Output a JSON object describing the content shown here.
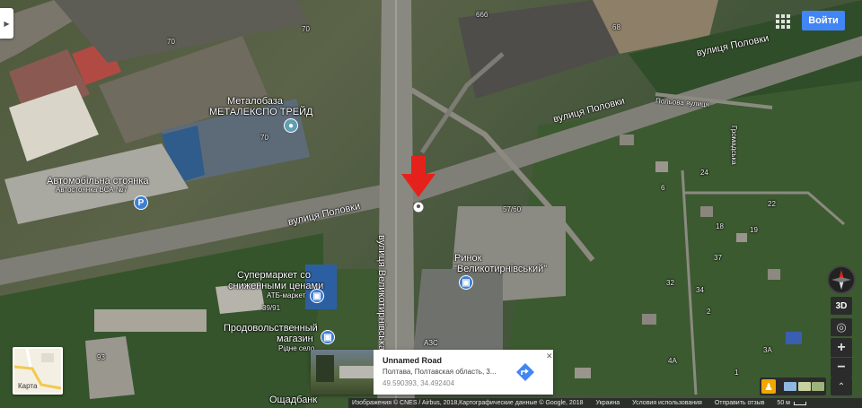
{
  "header": {
    "login_label": "Войти"
  },
  "map_labels": {
    "metalobaza": "Металобаза",
    "metalexpo": "МЕТАЛЕКСПО ТРЕЙД",
    "parking1": "Автомобільна стоянка",
    "parking2": "Автостоянка ВСА №7",
    "road_polovky_main": "вулиця Половки",
    "road_polovky_top": "вулиця Половки",
    "road_polovky_mid": "вулиця Половки",
    "road_polova": "Польова вулиця",
    "road_velykotyrnivska": "вулиця Великотирнівська",
    "supermarket1": "Супермаркет со",
    "supermarket2": "сниженными ценами",
    "supermarket3": "АТБ-маркет",
    "food1": "Продовольственный",
    "food2": "магазин",
    "food3": "Рідне село",
    "market1": "Ринок",
    "market2": "\"Великотирнівський\"",
    "azs": "АЗС",
    "oshchadbank": "Ощадбанк",
    "hromadska": "Громадська"
  },
  "house_numbers": [
    "70",
    "70",
    "66б",
    "68",
    "70",
    "57/60",
    "39/91",
    "93",
    "24",
    "22",
    "19",
    "18",
    "37",
    "34",
    "32",
    "3А",
    "4А",
    "6",
    "2",
    "1"
  ],
  "layer_toggle": {
    "label": "Карта"
  },
  "info_card": {
    "title": "Unnamed Road",
    "address": "Полтава, Полтавская область, 3...",
    "coords": "49.590393, 34.492404"
  },
  "controls": {
    "btn_3d": "3D"
  },
  "footer": {
    "attribution": "Изображения © CNES / Airbus, 2018,Картографические данные © Google, 2018",
    "region": "Украина",
    "terms": "Условия использования",
    "feedback": "Отправить отзыв",
    "scale": "50 м"
  },
  "colors": {
    "accent": "#4285f4",
    "marker_arrow": "#e4221b",
    "pegman": "#f2a600"
  },
  "icons": [
    "grid-apps-icon",
    "compass-icon",
    "my-location-icon",
    "zoom-in-icon",
    "zoom-out-icon",
    "pegman-icon",
    "directions-icon",
    "close-icon",
    "place-pin-icon",
    "shopping-bag-icon",
    "parking-icon",
    "red-arrow-marker-icon"
  ]
}
